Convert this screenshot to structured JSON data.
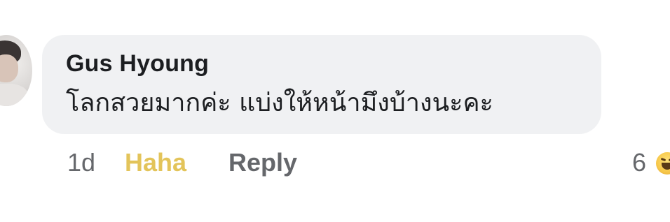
{
  "comment": {
    "author": "Gus Hyoung",
    "text": "โลกสวยมากค่ะ แบ่งให้หน้ามึงบ้างนะคะ",
    "time": "1d",
    "reaction_label": "Haha",
    "reply_label": "Reply",
    "reaction_count": "6",
    "reaction_icon": "haha-emoji-icon"
  },
  "colors": {
    "bubble": "#f0f1f3",
    "author": "#1c1e21",
    "meta": "#65676b",
    "haha": "#e3c45a"
  }
}
